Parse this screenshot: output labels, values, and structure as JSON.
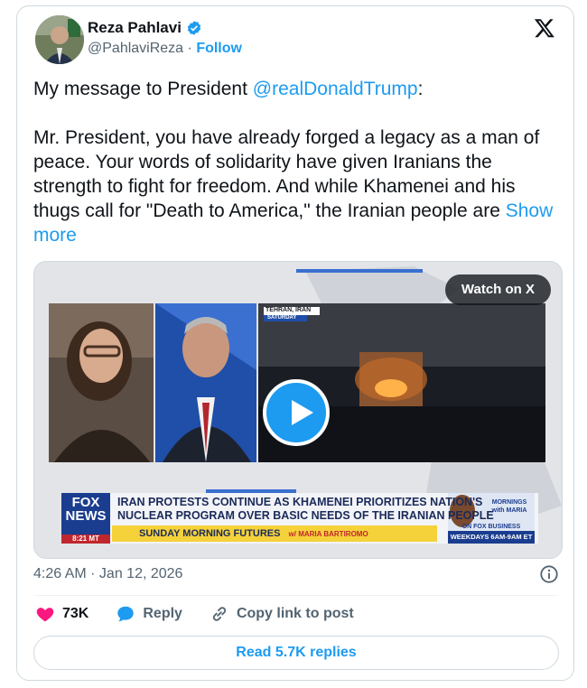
{
  "author": {
    "name": "Reza Pahlavi",
    "handle": "@PahlaviReza",
    "separator": "·",
    "follow_label": "Follow",
    "verified_icon": "verified-badge-icon",
    "verified_color": "#1d9bf0"
  },
  "platform_icon": "x-logo-icon",
  "post": {
    "line1_prefix": "My message to President ",
    "mention": "@realDonaldTrump",
    "line1_suffix": ":",
    "body": "Mr. President, you have already forged a legacy as a man of peace. Your words of solidarity have given Iranians the strength to fight for freedom. And while Khamenei and his thugs call for \"Death to America,\" the Iranian people are ",
    "show_more": "Show more"
  },
  "media": {
    "watch_label": "Watch on X",
    "play_icon": "play-icon",
    "location_tag": "TEHRAN, IRAN",
    "day_tag": "SATURDAY",
    "network_logo_line1": "FOX",
    "network_logo_line2": "NEWS",
    "clock": "8:21 MT",
    "headline_line1": "IRAN PROTESTS CONTINUE AS KHAMENEI PRIORITIZES NATION'S",
    "headline_line2": "NUCLEAR PROGRAM OVER BASIC NEEDS OF THE IRANIAN PEOPLE",
    "show_name": "SUNDAY MORNING FUTURES",
    "host": "w/ MARIA BARTIROMO",
    "promo_line1": "MORNINGS",
    "promo_line2": "with MARIA",
    "promo_network": "ON FOX BUSINESS",
    "promo_time": "WEEKDAYS 6AM-9AM ET"
  },
  "meta": {
    "timestamp": "4:26 AM · Jan 12, 2026",
    "info_icon": "info-icon"
  },
  "actions": {
    "like_count": "73K",
    "like_color": "#f91880",
    "reply_label": "Reply",
    "copy_label": "Copy link to post"
  },
  "read_replies_label": "Read 5.7K replies"
}
